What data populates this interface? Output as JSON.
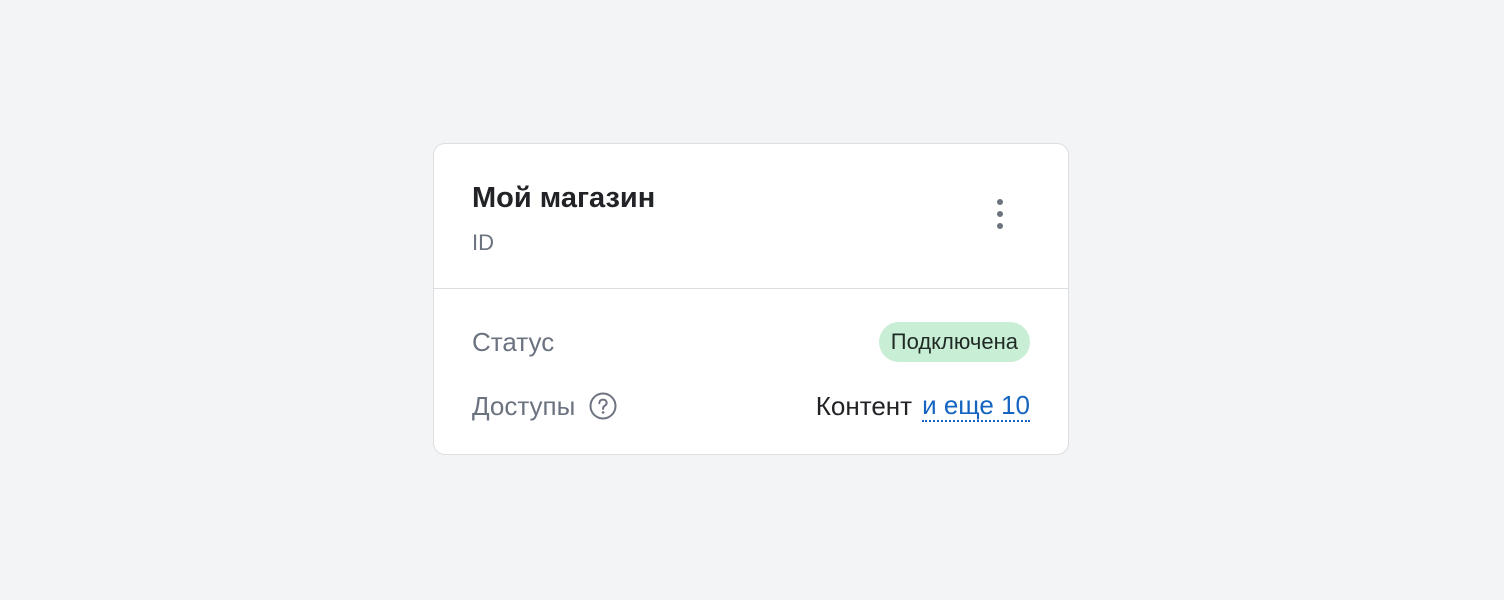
{
  "card": {
    "title": "Мой магазин",
    "subtitle": "ID",
    "menu_icon": "kebab-vertical-icon"
  },
  "rows": {
    "status": {
      "label": "Статус",
      "value": "Подключена",
      "badge_color": "#c9eed6"
    },
    "access": {
      "label": "Доступы",
      "help_icon": "question-circle-icon",
      "value": "Контент",
      "more_link": "и еще 10",
      "link_color": "#1565c0"
    }
  }
}
